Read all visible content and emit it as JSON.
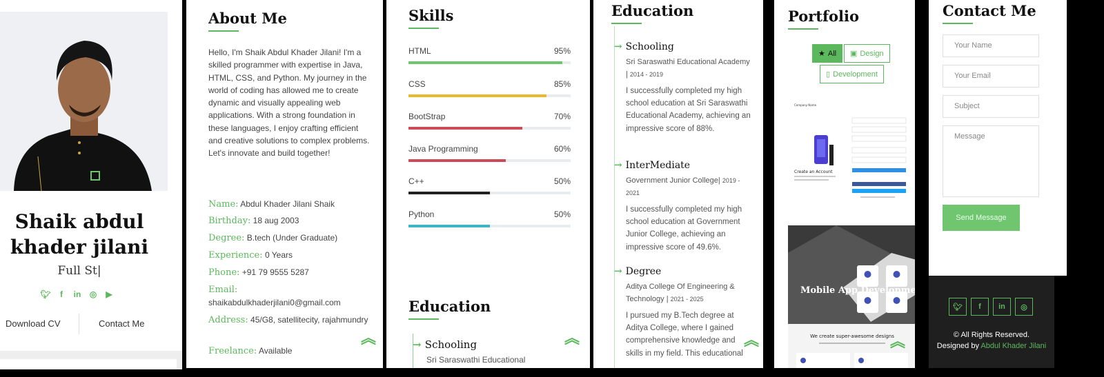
{
  "profile": {
    "name": "Shaik abdul khader jilani",
    "role": "Full St|",
    "social_icons": [
      "twitter-icon",
      "facebook-icon",
      "linkedin-icon",
      "instagram-icon",
      "youtube-icon"
    ],
    "download_cv": "Download CV",
    "contact_me": "Contact Me"
  },
  "about": {
    "title": "About Me",
    "intro": "Hello, I'm Shaik Abdul Khader Jilani! I'm a skilled programmer with expertise in Java, HTML, CSS, and Python. My journey in the world of coding has allowed me to create dynamic and visually appealing web applications. With a strong foundation in these languages, I enjoy crafting efficient and creative solutions to complex problems. Let's innovate and build together!",
    "fields": [
      {
        "label": "Name:",
        "value": "Abdul Khader Jilani Shaik"
      },
      {
        "label": "Birthday:",
        "value": "18 aug 2003"
      },
      {
        "label": "Degree:",
        "value": "B.tech (Under Graduate)"
      },
      {
        "label": "Experience:",
        "value": "0 Years"
      },
      {
        "label": "Phone:",
        "value": "+91 79 9555 5287"
      },
      {
        "label": "Email:",
        "value": "shaikabdulkhaderjilani0@gmail.com"
      },
      {
        "label": "Address:",
        "value": "45/G8, satellitecity, rajahmundry"
      },
      {
        "label": "Freelance:",
        "value": "Available"
      }
    ]
  },
  "skills": {
    "title": "Skills",
    "items": [
      {
        "name": "HTML",
        "percent_label": "95%",
        "value": 0.95,
        "color": "#6cc76c"
      },
      {
        "name": "CSS",
        "percent_label": "85%",
        "value": 0.85,
        "color": "#e9b92c"
      },
      {
        "name": "BootStrap",
        "percent_label": "70%",
        "value": 0.7,
        "color": "#cf4a57"
      },
      {
        "name": "Java Programming",
        "percent_label": "60%",
        "value": 0.6,
        "color": "#cf4a57"
      },
      {
        "name": "C++",
        "percent_label": "50%",
        "value": 0.5,
        "color": "#222222"
      },
      {
        "name": "Python",
        "percent_label": "50%",
        "value": 0.5,
        "color": "#3fb4c2"
      }
    ],
    "education_title": "Education",
    "education_preview_title": "Schooling",
    "education_preview_sub": "Sri Saraswathi Educational"
  },
  "education": {
    "title": "Education",
    "items": [
      {
        "title": "Schooling",
        "school": "Sri Saraswathi Educational Academy |",
        "years": "2014 - 2019",
        "desc": "I successfully completed my high school education at Sri Saraswathi Educational Academy, achieving an impressive score of 88%."
      },
      {
        "title": "InterMediate",
        "school": "Government Junior College|",
        "years": "2019 - 2021",
        "desc": "I successfully completed my high school education at Government Junior College, achieving an impressive score of 49.6%."
      },
      {
        "title": "Degree",
        "school": "Aditya College Of Engineering & Technology |",
        "years": "2021 - 2025",
        "desc": "I pursued my B.Tech degree at Aditya College, where I gained comprehensive knowledge and skills in my field. This educational"
      }
    ]
  },
  "portfolio": {
    "title": "Portfolio",
    "filters": [
      {
        "label": "All",
        "icon": "star-icon"
      },
      {
        "label": "Design",
        "icon": "card-icon"
      },
      {
        "label": "Development",
        "icon": "mobile-icon"
      }
    ],
    "thumb1_header": "Company Name",
    "thumb1_caption": "Create an Account",
    "thumb2_title": "Mobile App Development",
    "thumb2_banner": "We create super-awesome designs"
  },
  "contact": {
    "title": "Contact Me",
    "name_placeholder": "Your Name",
    "email_placeholder": "Your Email",
    "subject_placeholder": "Subject",
    "message_placeholder": "Message",
    "send_label": "Send Message",
    "footer_icons": [
      "twitter-icon",
      "facebook-icon",
      "linkedin-icon",
      "instagram-icon"
    ],
    "copyright": "© All Rights Reserved.",
    "designed_by": "Designed by",
    "designer": "Abdul Khader Jilani"
  },
  "colors": {
    "accent": "#5cb85c",
    "footer": "#1f1f1f"
  }
}
